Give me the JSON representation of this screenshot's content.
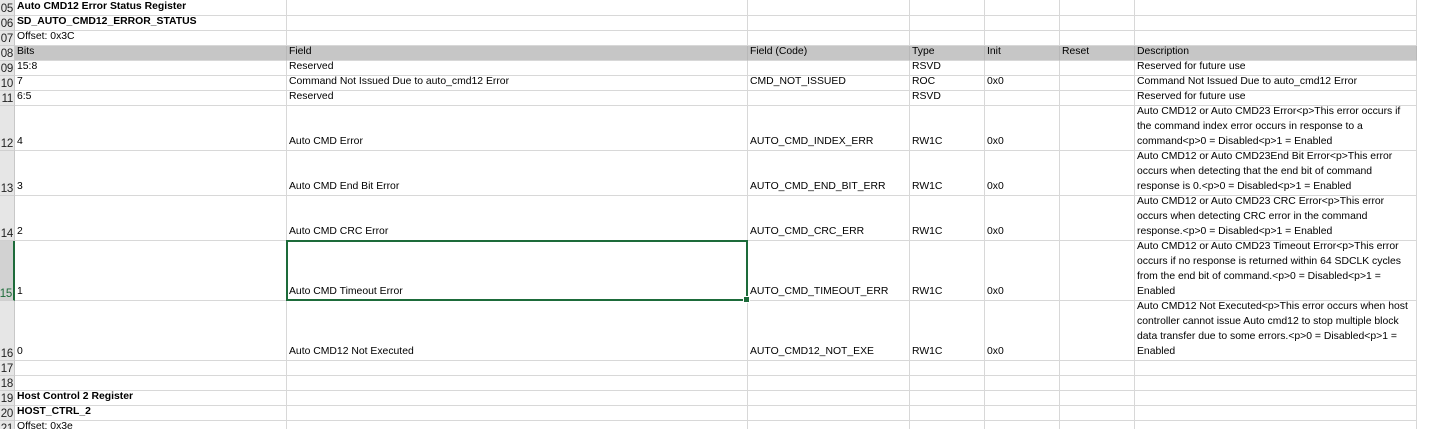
{
  "sheet": {
    "rows": [
      {
        "row_label": "05",
        "cells": [
          "Auto CMD12 Error Status Register",
          "",
          "",
          "",
          "",
          "",
          ""
        ],
        "style": "bold"
      },
      {
        "row_label": "06",
        "cells": [
          "SD_AUTO_CMD12_ERROR_STATUS",
          "",
          "",
          "",
          "",
          "",
          ""
        ],
        "style": "bold"
      },
      {
        "row_label": "07",
        "cells": [
          "Offset: 0x3C",
          "",
          "",
          "",
          "",
          "",
          ""
        ],
        "style": "normal"
      },
      {
        "row_label": "08",
        "cells": [
          "Bits",
          "Field",
          "Field (Code)",
          "Type",
          "Init",
          "Reset",
          "Description"
        ],
        "style": "header"
      },
      {
        "row_label": "09",
        "cells": [
          "15:8",
          "Reserved",
          "",
          "RSVD",
          "",
          "",
          "Reserved for future use"
        ],
        "style": "normal"
      },
      {
        "row_label": "10",
        "cells": [
          "7",
          "Command Not Issued Due to auto_cmd12 Error",
          "CMD_NOT_ISSUED",
          "ROC",
          "0x0",
          "",
          "Command Not Issued Due to auto_cmd12 Error"
        ],
        "style": "normal"
      },
      {
        "row_label": "11",
        "cells": [
          "6:5",
          "Reserved",
          "",
          "RSVD",
          "",
          "",
          "Reserved for future use"
        ],
        "style": "normal"
      },
      {
        "row_label": "12",
        "cells": [
          "4",
          "Auto CMD Error",
          "AUTO_CMD_INDEX_ERR",
          "RW1C",
          "0x0",
          "",
          "Auto CMD12 or Auto CMD23 Error<p>This error occurs if the command index error occurs in response to a command<p>0 = Disabled<p>1 = Enabled"
        ],
        "style": "normal"
      },
      {
        "row_label": "13",
        "cells": [
          "3",
          "Auto CMD End Bit Error",
          "AUTO_CMD_END_BIT_ERR",
          "RW1C",
          "0x0",
          "",
          "Auto CMD12 or Auto CMD23End Bit Error<p>This error occurs when detecting that the end bit of command response is 0.<p>0 = Disabled<p>1 = Enabled"
        ],
        "style": "normal"
      },
      {
        "row_label": "14",
        "cells": [
          "2",
          "Auto CMD CRC Error",
          "AUTO_CMD_CRC_ERR",
          "RW1C",
          "0x0",
          "",
          "Auto CMD12 or Auto CMD23 CRC Error<p>This error occurs when detecting CRC error in the command response.<p>0 = Disabled<p>1 = Enabled"
        ],
        "style": "normal"
      },
      {
        "row_label": "15",
        "cells": [
          "1",
          "Auto CMD Timeout Error",
          "AUTO_CMD_TIMEOUT_ERR",
          "RW1C",
          "0x0",
          "",
          "Auto CMD12 or Auto CMD23 Timeout Error<p>This error occurs if no response is returned within 64 SDCLK cycles from the end bit of command.<p>0 = Disabled<p>1 = Enabled"
        ],
        "style": "normal"
      },
      {
        "row_label": "16",
        "cells": [
          "0",
          "Auto CMD12 Not Executed",
          "AUTO_CMD12_NOT_EXE",
          "RW1C",
          "0x0",
          "",
          "Auto CMD12 Not Executed<p>This error occurs when host controller cannot issue Auto cmd12 to stop multiple block data transfer due to some errors.<p>0 = Disabled<p>1 = Enabled"
        ],
        "style": "normal"
      },
      {
        "row_label": "17",
        "cells": [
          "",
          "",
          "",
          "",
          "",
          "",
          ""
        ],
        "style": "normal"
      },
      {
        "row_label": "18",
        "cells": [
          "",
          "",
          "",
          "",
          "",
          "",
          ""
        ],
        "style": "normal"
      },
      {
        "row_label": "19",
        "cells": [
          "Host Control 2 Register",
          "",
          "",
          "",
          "",
          "",
          ""
        ],
        "style": "bold"
      },
      {
        "row_label": "20",
        "cells": [
          "HOST_CTRL_2",
          "",
          "",
          "",
          "",
          "",
          ""
        ],
        "style": "bold"
      },
      {
        "row_label": "21",
        "cells": [
          "Offset: 0x3e",
          "",
          "",
          "",
          "",
          "",
          ""
        ],
        "style": "normal"
      }
    ],
    "active_row_label": "15",
    "selected_cell": {
      "row_label": "15",
      "column": "Field"
    }
  }
}
